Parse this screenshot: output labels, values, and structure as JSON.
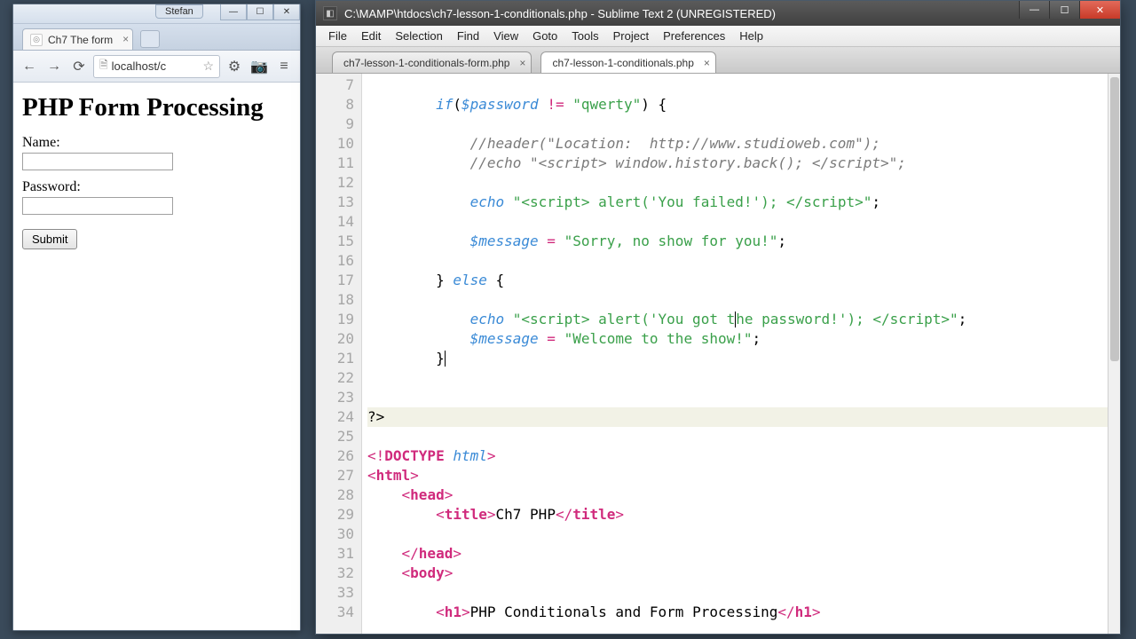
{
  "browser": {
    "user_badge": "Stefan",
    "win_min": "—",
    "win_max": "☐",
    "win_close": "✕",
    "tab_title": "Ch7 The form",
    "url_display": "localhost/c",
    "nav": {
      "back": "←",
      "forward": "→",
      "reload": "⟳"
    },
    "star": "☆",
    "tools": {
      "gear": "⚙",
      "camera": "📷",
      "menu": "≡"
    }
  },
  "page": {
    "heading": "PHP Form Processing",
    "name_label": "Name:",
    "password_label": "Password:",
    "submit_label": "Submit"
  },
  "sublime": {
    "title": "C:\\MAMP\\htdocs\\ch7-lesson-1-conditionals.php - Sublime Text 2 (UNREGISTERED)",
    "win_min": "—",
    "win_max": "☐",
    "win_close": "✕",
    "menus": [
      "File",
      "Edit",
      "Selection",
      "Find",
      "View",
      "Goto",
      "Tools",
      "Project",
      "Preferences",
      "Help"
    ],
    "tabs": [
      {
        "label": "ch7-lesson-1-conditionals-form.php",
        "active": false
      },
      {
        "label": "ch7-lesson-1-conditionals.php",
        "active": true
      }
    ],
    "first_line_no": 7,
    "line_count": 28,
    "highlight_lines": [
      24
    ]
  }
}
